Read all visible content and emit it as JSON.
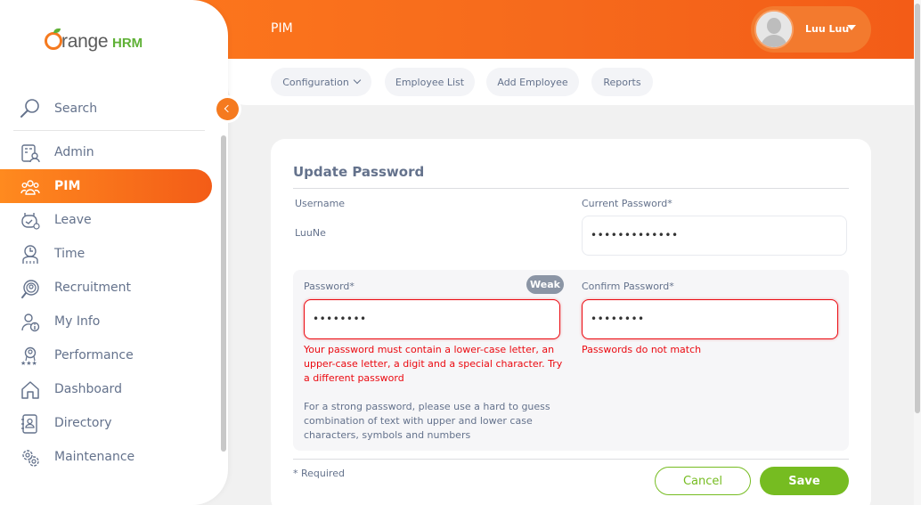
{
  "brand": {
    "orange_text": "range",
    "hrm_text": "HRM",
    "accent": "#f57a1f",
    "green": "#76bc21"
  },
  "header": {
    "module_title": "PIM",
    "user_name": "Luu Luu"
  },
  "tabs": [
    {
      "label": "Configuration",
      "has_dropdown": true
    },
    {
      "label": "Employee List"
    },
    {
      "label": "Add Employee"
    },
    {
      "label": "Reports"
    }
  ],
  "sidebar": {
    "search_label": "Search",
    "items": [
      {
        "label": "Admin",
        "icon": "admin-icon"
      },
      {
        "label": "PIM",
        "icon": "pim-icon",
        "active": true
      },
      {
        "label": "Leave",
        "icon": "leave-icon"
      },
      {
        "label": "Time",
        "icon": "time-icon"
      },
      {
        "label": "Recruitment",
        "icon": "recruitment-icon"
      },
      {
        "label": "My Info",
        "icon": "my-info-icon"
      },
      {
        "label": "Performance",
        "icon": "performance-icon"
      },
      {
        "label": "Dashboard",
        "icon": "dashboard-icon"
      },
      {
        "label": "Directory",
        "icon": "directory-icon"
      },
      {
        "label": "Maintenance",
        "icon": "maintenance-icon"
      }
    ]
  },
  "form": {
    "title": "Update Password",
    "username_label": "Username",
    "username_value": "LuuNe",
    "current_password_label": "Current Password*",
    "current_password_value": "•••••••••••••",
    "password_label": "Password*",
    "password_value": "••••••••",
    "strength_badge": "Weak",
    "confirm_password_label": "Confirm Password*",
    "confirm_password_value": "••••••••",
    "password_error": "Your password must contain a lower-case letter, an upper-case letter, a digit and a special character. Try a different password",
    "confirm_error": "Passwords do not match",
    "hint": "For a strong password, please use a hard to guess combination of text with upper and lower case characters, symbols and numbers",
    "required_note": "* Required",
    "cancel_label": "Cancel",
    "save_label": "Save",
    "error_color": "#eb0910"
  }
}
